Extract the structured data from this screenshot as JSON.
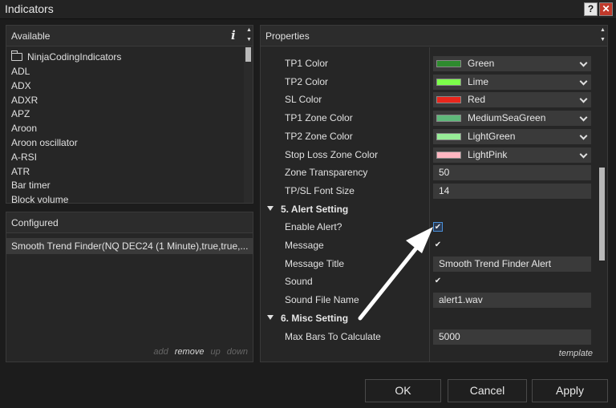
{
  "window": {
    "title": "Indicators",
    "help_label": "?",
    "close_label": "✕"
  },
  "available": {
    "header": "Available",
    "info_glyph": "i",
    "items": [
      {
        "label": "NinjaCodingIndicators",
        "icon": "folder-icon"
      },
      {
        "label": "ADL"
      },
      {
        "label": "ADX"
      },
      {
        "label": "ADXR"
      },
      {
        "label": "APZ"
      },
      {
        "label": "Aroon"
      },
      {
        "label": "Aroon oscillator"
      },
      {
        "label": "A-RSI"
      },
      {
        "label": "ATR"
      },
      {
        "label": "Bar timer"
      },
      {
        "label": "Block volume"
      }
    ]
  },
  "configured": {
    "header": "Configured",
    "item": "Smooth Trend Finder(NQ DEC24 (1 Minute),true,true,...",
    "actions": {
      "add": "add",
      "remove": "remove",
      "up": "up",
      "down": "down"
    }
  },
  "properties": {
    "header": "Properties",
    "rows": {
      "tp1_color": {
        "name": "TP1 Color",
        "value": "Green",
        "swatch": "#2e8b2e"
      },
      "tp2_color": {
        "name": "TP2 Color",
        "value": "Lime",
        "swatch": "#7cff4a"
      },
      "sl_color": {
        "name": "SL Color",
        "value": "Red",
        "swatch": "#e8261c"
      },
      "tp1_zone_color": {
        "name": "TP1 Zone Color",
        "value": "MediumSeaGreen",
        "swatch": "#5fb87a"
      },
      "tp2_zone_color": {
        "name": "TP2 Zone Color",
        "value": "LightGreen",
        "swatch": "#98ec98"
      },
      "sl_zone_color": {
        "name": "Stop Loss Zone Color",
        "value": "LightPink",
        "swatch": "#ffb6c1"
      },
      "zone_transparency": {
        "name": "Zone Transparency",
        "value": "50"
      },
      "font_size": {
        "name": "TP/SL Font Size",
        "value": "14"
      },
      "section_alert": {
        "name": "5. Alert Setting"
      },
      "enable_alert": {
        "name": "Enable Alert?",
        "checked": true
      },
      "message": {
        "name": "Message",
        "checked": true
      },
      "message_title": {
        "name": "Message Title",
        "value": "Smooth Trend Finder Alert"
      },
      "sound": {
        "name": "Sound",
        "checked": true
      },
      "sound_file": {
        "name": "Sound File Name",
        "value": "alert1.wav"
      },
      "section_misc": {
        "name": "6. Misc Setting"
      },
      "max_bars": {
        "name": "Max Bars To Calculate",
        "value": "5000"
      }
    },
    "template_label": "template",
    "check_glyph": "✔"
  },
  "buttons": {
    "ok": "OK",
    "cancel": "Cancel",
    "apply": "Apply"
  }
}
